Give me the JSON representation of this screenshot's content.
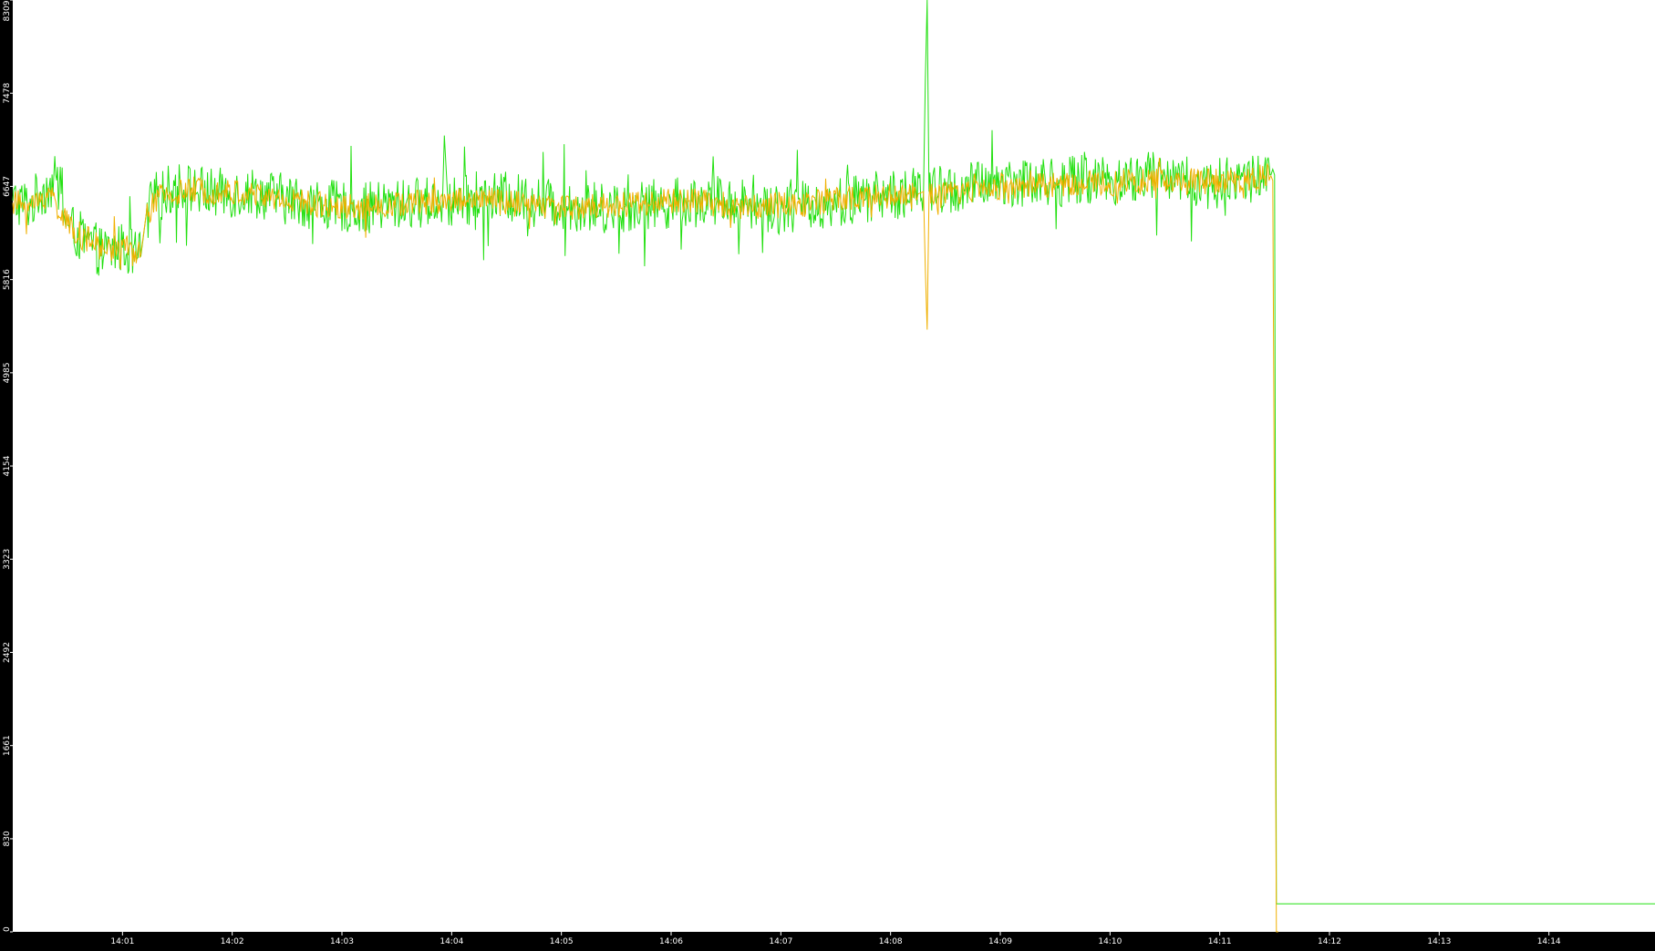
{
  "chart_data": {
    "type": "line",
    "title": "",
    "xlabel": "",
    "ylabel": "",
    "x_ticks": [
      "14:01",
      "14:02",
      "14:03",
      "14:04",
      "14:05",
      "14:06",
      "14:07",
      "14:08",
      "14:09",
      "14:10",
      "14:11",
      "14:12",
      "14:13",
      "14:14"
    ],
    "y_ticks": [
      0,
      830,
      1661,
      2492,
      3323,
      4154,
      4985,
      5816,
      6647,
      7478,
      8309
    ],
    "xlim": [
      "14:00:00",
      "14:14:58"
    ],
    "ylim": [
      0,
      8309
    ],
    "grid": false,
    "legend": "none",
    "background_color": "#ffffff",
    "axis_color": "#000000",
    "series": [
      {
        "color": "#22e010",
        "points": [
          [
            "14:00:00",
            6520
          ],
          [
            "14:00:10",
            6480
          ],
          [
            "14:00:15",
            6600
          ],
          [
            "14:00:20",
            6650
          ],
          [
            "14:00:24",
            6700
          ],
          [
            "14:00:30",
            6300
          ],
          [
            "14:00:40",
            6150
          ],
          [
            "14:00:50",
            6050
          ],
          [
            "14:01:00",
            6100
          ],
          [
            "14:01:10",
            6020
          ],
          [
            "14:01:13",
            6400
          ],
          [
            "14:01:18",
            6550
          ],
          [
            "14:01:30",
            6650
          ],
          [
            "14:01:50",
            6580
          ],
          [
            "14:02:10",
            6600
          ],
          [
            "14:02:40",
            6500
          ],
          [
            "14:03:10",
            6450
          ],
          [
            "14:03:40",
            6500
          ],
          [
            "14:03:55",
            6520
          ],
          [
            "14:03:56",
            7100
          ],
          [
            "14:03:58",
            6500
          ],
          [
            "14:04:30",
            6550
          ],
          [
            "14:05:00",
            6480
          ],
          [
            "14:05:30",
            6450
          ],
          [
            "14:06:00",
            6500
          ],
          [
            "14:06:30",
            6520
          ],
          [
            "14:07:00",
            6450
          ],
          [
            "14:07:30",
            6500
          ],
          [
            "14:07:50",
            6560
          ],
          [
            "14:08:18",
            6600
          ],
          [
            "14:08:19",
            7600
          ],
          [
            "14:08:20",
            8309
          ],
          [
            "14:08:21",
            6600
          ],
          [
            "14:08:40",
            6620
          ],
          [
            "14:09:00",
            6700
          ],
          [
            "14:09:30",
            6680
          ],
          [
            "14:09:50",
            6720
          ],
          [
            "14:10:10",
            6700
          ],
          [
            "14:10:30",
            6750
          ],
          [
            "14:10:50",
            6650
          ],
          [
            "14:11:10",
            6700
          ],
          [
            "14:11:28",
            6750
          ],
          [
            "14:11:29",
            6800
          ],
          [
            "14:11:30",
            6750
          ],
          [
            "14:11:31",
            250
          ],
          [
            "14:11:32",
            250
          ],
          [
            "14:14:58",
            250
          ]
        ]
      },
      {
        "color": "#f0b000",
        "points": [
          [
            "14:00:00",
            6500
          ],
          [
            "14:00:12",
            6480
          ],
          [
            "14:00:20",
            6600
          ],
          [
            "14:00:30",
            6300
          ],
          [
            "14:00:40",
            6180
          ],
          [
            "14:00:50",
            6080
          ],
          [
            "14:01:00",
            6120
          ],
          [
            "14:01:10",
            6040
          ],
          [
            "14:01:13",
            6400
          ],
          [
            "14:01:20",
            6550
          ],
          [
            "14:01:40",
            6620
          ],
          [
            "14:02:10",
            6580
          ],
          [
            "14:02:40",
            6500
          ],
          [
            "14:03:10",
            6460
          ],
          [
            "14:03:40",
            6500
          ],
          [
            "14:04:10",
            6540
          ],
          [
            "14:04:40",
            6480
          ],
          [
            "14:05:10",
            6460
          ],
          [
            "14:05:40",
            6500
          ],
          [
            "14:06:10",
            6520
          ],
          [
            "14:06:40",
            6470
          ],
          [
            "14:07:10",
            6490
          ],
          [
            "14:07:40",
            6540
          ],
          [
            "14:08:15",
            6580
          ],
          [
            "14:08:18",
            6600
          ],
          [
            "14:08:19",
            5900
          ],
          [
            "14:08:20",
            5370
          ],
          [
            "14:08:21",
            6550
          ],
          [
            "14:08:40",
            6600
          ],
          [
            "14:09:00",
            6650
          ],
          [
            "14:09:30",
            6660
          ],
          [
            "14:10:00",
            6680
          ],
          [
            "14:10:30",
            6700
          ],
          [
            "14:11:00",
            6690
          ],
          [
            "14:11:28",
            6740
          ],
          [
            "14:11:29",
            6700
          ],
          [
            "14:11:30",
            3400
          ],
          [
            "14:11:31",
            0
          ],
          [
            "14:11:32",
            0
          ]
        ]
      }
    ]
  }
}
